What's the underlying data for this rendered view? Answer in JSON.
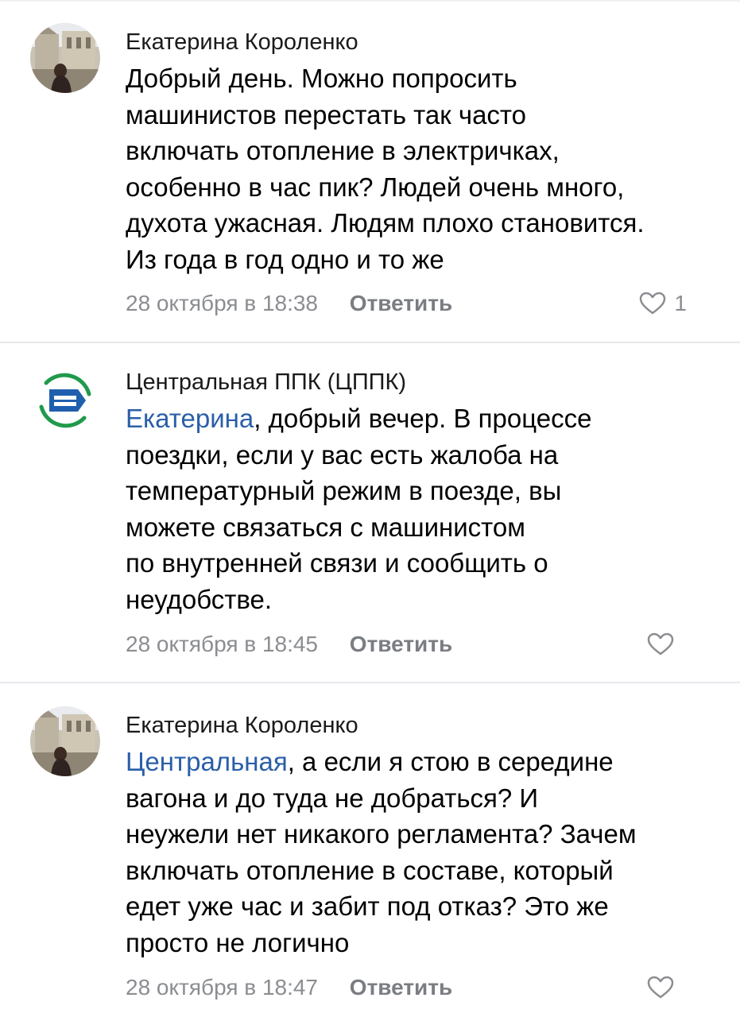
{
  "comments": [
    {
      "author": "Екатерина Короленко",
      "mention": "",
      "text_lines": [
        "Добрый день. Можно попросить",
        "машинистов перестать так часто",
        "включать отопление в электричках,",
        "особенно в час пик? Людей очень много,",
        "духота ужасная. Людям плохо становится.",
        "Из года в год одно и то же"
      ],
      "date": "28 октября в 18:38",
      "reply_label": "Ответить",
      "likes": "1",
      "avatar_icon": "user-photo-icon"
    },
    {
      "author": "Центральная ППК (ЦППК)",
      "mention": "Екатерина",
      "first_line_rest": ", добрый вечер. В процессе",
      "text_lines": [
        "поездки, если у вас есть жалоба на",
        "температурный режим в поезде, вы",
        "можете связаться с машинистом",
        "по внутренней связи и сообщить о",
        "неудобстве."
      ],
      "date": "28 октября в 18:45",
      "reply_label": "Ответить",
      "likes": "",
      "avatar_icon": "company-logo-icon"
    },
    {
      "author": "Екатерина Короленко",
      "mention": "Центральная",
      "first_line_rest": ", а если я стою в середине",
      "text_lines": [
        "вагона и до туда не добраться? И",
        "неужели нет никакого регламента? Зачем",
        "включать отопление в составе, который",
        "едет уже час и забит под отказ? Это же",
        "просто не логично"
      ],
      "date": "28 октября в 18:47",
      "reply_label": "Ответить",
      "likes": "",
      "avatar_icon": "user-photo-icon"
    }
  ],
  "colors": {
    "mention": "#2a5fa8",
    "meta": "#8b8d91",
    "logo_blue": "#1f5fae",
    "logo_green": "#1f9a4b"
  }
}
